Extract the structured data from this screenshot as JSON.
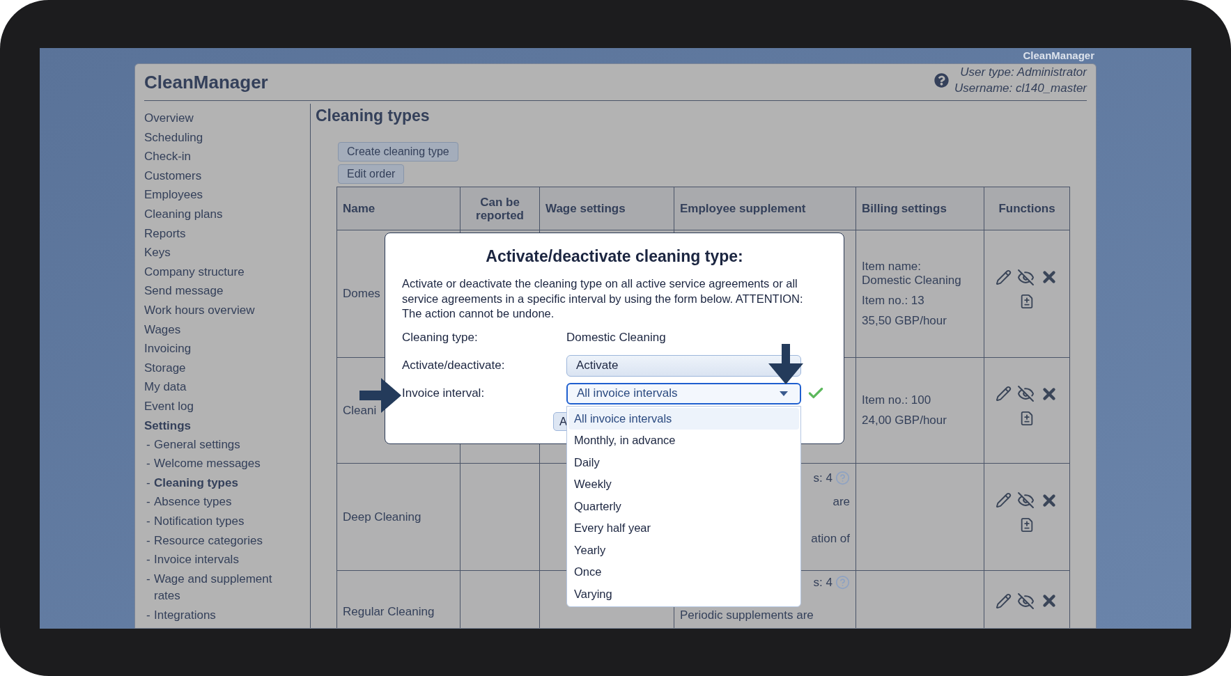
{
  "screen_title": "CleanManager",
  "header": {
    "title": "CleanManager",
    "user_type": "User type: Administrator",
    "username": "Username: cl140_master"
  },
  "sidebar": {
    "items": [
      {
        "label": "Overview",
        "selected": false
      },
      {
        "label": "Scheduling",
        "selected": false
      },
      {
        "label": "Check-in",
        "selected": false
      },
      {
        "label": "Customers",
        "selected": false
      },
      {
        "label": "Employees",
        "selected": false
      },
      {
        "label": "Cleaning plans",
        "selected": false
      },
      {
        "label": "Reports",
        "selected": false
      },
      {
        "label": "Keys",
        "selected": false
      },
      {
        "label": "Company structure",
        "selected": false
      },
      {
        "label": "Send message",
        "selected": false
      },
      {
        "label": "Work hours overview",
        "selected": false
      },
      {
        "label": "Wages",
        "selected": false
      },
      {
        "label": "Invoicing",
        "selected": false
      },
      {
        "label": "Storage",
        "selected": false
      },
      {
        "label": "My data",
        "selected": false
      },
      {
        "label": "Event log",
        "selected": false
      },
      {
        "label": "Settings",
        "selected": true,
        "children": [
          {
            "marker": "-",
            "label": "General settings",
            "selected": false
          },
          {
            "marker": "-",
            "label": "Welcome messages",
            "selected": false
          },
          {
            "marker": "-",
            "label": "Cleaning types",
            "selected": true
          },
          {
            "marker": "-",
            "label": "Absence types",
            "selected": false
          },
          {
            "marker": "-",
            "label": "Notification types",
            "selected": false
          },
          {
            "marker": "-",
            "label": "Resource categories",
            "selected": false
          },
          {
            "marker": "-",
            "label": "Invoice intervals",
            "selected": false
          },
          {
            "marker": "-",
            "label": "Wage and supplement rates",
            "selected": false
          },
          {
            "marker": "-",
            "label": "Integrations",
            "selected": false
          }
        ]
      }
    ]
  },
  "page": {
    "title": "Cleaning types",
    "buttons": [
      "Create cleaning type",
      "Edit order"
    ]
  },
  "table": {
    "columns": [
      "Name",
      "Can be reported",
      "Wage settings",
      "Employee supplement",
      "Billing settings",
      "Functions"
    ],
    "rows": [
      {
        "name": "Domes",
        "supplement": [],
        "billing": [
          "Item name:\nDomestic Cleaning",
          "Item no.: 13",
          "35,50 GBP/hour"
        ],
        "second_icon_row": true
      },
      {
        "name": "Cleani",
        "supplement": [],
        "billing": [
          "Item no.: 100",
          "24,00 GBP/hour"
        ],
        "second_icon_row": true
      },
      {
        "name": "Deep Cleaning",
        "supplement": [
          {
            "kind": "clipped",
            "parts": [
              {
                "kind": "text",
                "text": "s: 4"
              },
              {
                "kind": "help"
              }
            ]
          },
          {
            "kind": "clipped",
            "parts": [
              {
                "kind": "text",
                "text": "are"
              }
            ]
          },
          {
            "kind": "clipped",
            "parts": [
              {
                "kind": "text",
                "text": "ation of"
              }
            ]
          }
        ],
        "billing": [],
        "second_icon_row": true
      },
      {
        "name": "Regular Cleaning",
        "supplement": [
          {
            "kind": "clipped",
            "parts": [
              {
                "kind": "text",
                "text": "s: 4"
              },
              {
                "kind": "help"
              }
            ]
          },
          {
            "kind": "full",
            "parts": [
              {
                "kind": "text",
                "text": "Periodic supplements are"
              }
            ]
          }
        ],
        "billing": [],
        "second_icon_row": false
      }
    ]
  },
  "dialog": {
    "title": "Activate/deactivate cleaning type:",
    "text": "Activate or deactivate the cleaning type on all active service agreements or all service agreements in a specific interval by using the form below. ATTENTION: The action cannot be undone.",
    "fields": [
      {
        "label": "Cleaning type:",
        "kind": "text",
        "value": "Domestic Cleaning"
      },
      {
        "label": "Activate/deactivate:",
        "kind": "select",
        "value": "Activate",
        "focused": false
      },
      {
        "label": "Invoice interval:",
        "kind": "select",
        "value": "All invoice intervals",
        "focused": true,
        "valid": true,
        "expanded": true,
        "options": [
          {
            "label": "All invoice intervals",
            "selected": true
          },
          {
            "label": "Monthly, in advance",
            "selected": false
          },
          {
            "label": "Daily",
            "selected": false
          },
          {
            "label": "Weekly",
            "selected": false
          },
          {
            "label": "Quarterly",
            "selected": false
          },
          {
            "label": "Every half year",
            "selected": false
          },
          {
            "label": "Yearly",
            "selected": false
          },
          {
            "label": "Once",
            "selected": false
          },
          {
            "label": "Varying",
            "selected": false
          }
        ]
      }
    ],
    "button": "A"
  }
}
